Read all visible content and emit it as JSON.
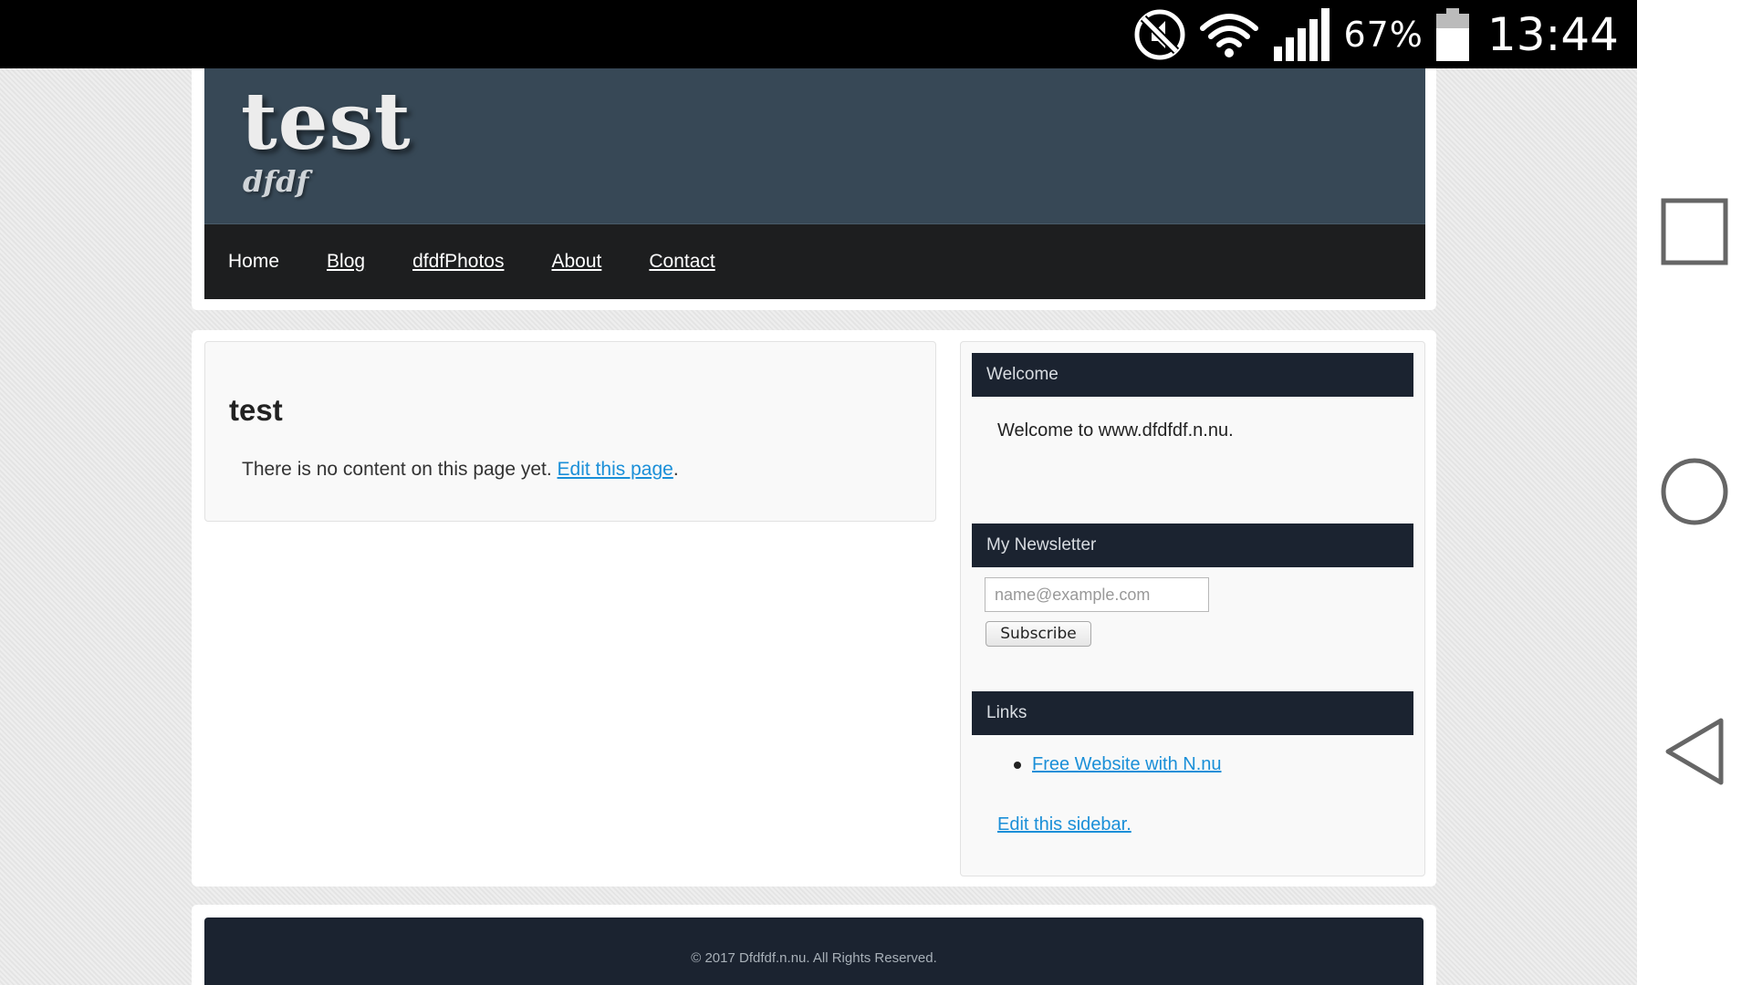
{
  "status_bar": {
    "battery_percent": "67%",
    "time": "13:44",
    "icons": [
      "mute-icon",
      "wifi-icon",
      "signal-icon",
      "battery-icon"
    ]
  },
  "site": {
    "title": "test",
    "tagline": "dfdf"
  },
  "menu": {
    "items": [
      {
        "label": "Home"
      },
      {
        "label": "Blog"
      },
      {
        "label": "dfdfPhotos"
      },
      {
        "label": "About"
      },
      {
        "label": "Contact"
      }
    ]
  },
  "main": {
    "title": "test",
    "text": "There is no content on this page yet. ",
    "edit_link": "Edit this page",
    "period": "."
  },
  "sidebar": {
    "welcome": {
      "heading": "Welcome",
      "text": "Welcome to www.dfdfdf.n.nu."
    },
    "newsletter": {
      "heading": "My Newsletter",
      "placeholder": "name@example.com",
      "button": "Subscribe"
    },
    "links": {
      "heading": "Links",
      "items": [
        "Free Website with N.nu"
      ],
      "edit": "Edit this sidebar."
    }
  },
  "footer": {
    "text": "© 2017 Dfdfdf.n.nu. All Rights Reserved."
  },
  "colors": {
    "header_banner": "#374856",
    "menu_bg": "#1d1e1f",
    "widget_head": "#1b2330",
    "link": "#1a8fd8"
  },
  "nav_buttons": [
    "recent-apps-icon",
    "home-icon",
    "back-icon"
  ]
}
